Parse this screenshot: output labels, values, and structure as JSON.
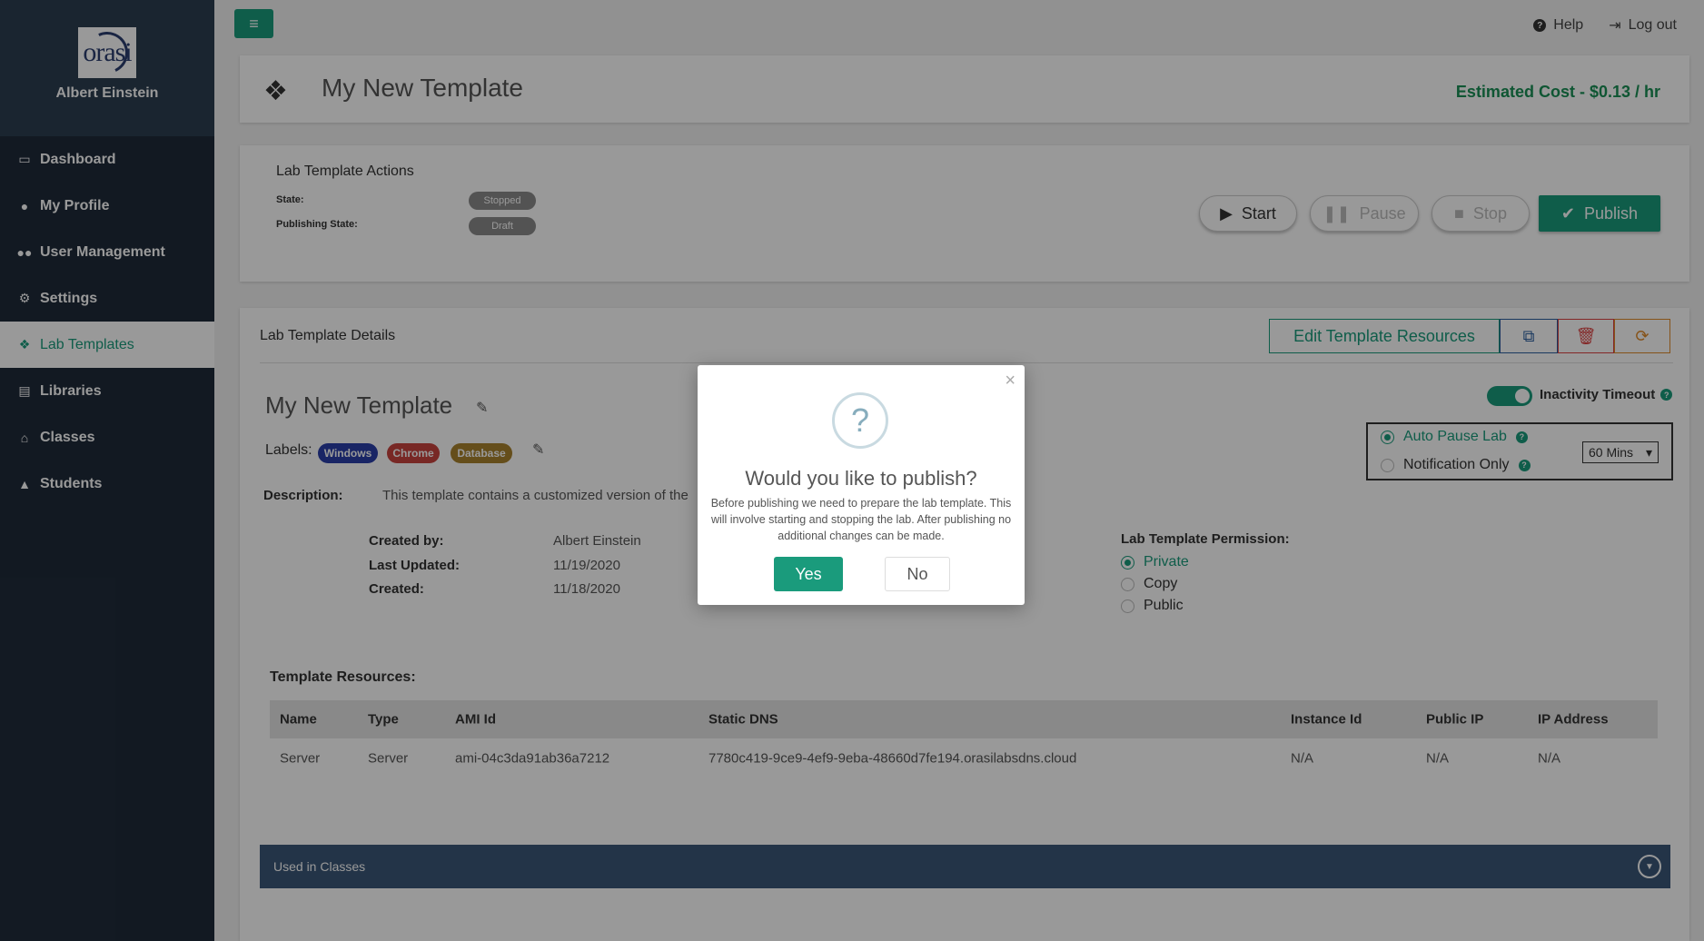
{
  "sidebar": {
    "logo_text": "orasi",
    "user_name": "Albert Einstein",
    "items": [
      {
        "label": "Dashboard",
        "icon": "monitor-icon"
      },
      {
        "label": "My Profile",
        "icon": "user-icon"
      },
      {
        "label": "User Management",
        "icon": "users-icon"
      },
      {
        "label": "Settings",
        "icon": "gear-icon"
      },
      {
        "label": "Lab Templates",
        "icon": "cubes-icon",
        "active": true
      },
      {
        "label": "Libraries",
        "icon": "book-icon"
      },
      {
        "label": "Classes",
        "icon": "bank-icon"
      },
      {
        "label": "Students",
        "icon": "graduation-cap-icon"
      }
    ]
  },
  "topbar": {
    "help_label": "Help",
    "logout_label": "Log out"
  },
  "header": {
    "title": "My New Template",
    "cost": "Estimated Cost - $0.13 / hr"
  },
  "actions": {
    "title": "Lab Template Actions",
    "state_label": "State:",
    "state_value": "Stopped",
    "publishing_label": "Publishing State:",
    "publishing_value": "Draft",
    "start_label": "Start",
    "pause_label": "Pause",
    "stop_label": "Stop",
    "publish_label": "Publish"
  },
  "details": {
    "title": "Lab Template Details",
    "edit_resources_label": "Edit Template Resources",
    "template_name": "My New Template",
    "labels_label": "Labels:",
    "labels": [
      {
        "text": "Windows",
        "color": "#2a3fa8"
      },
      {
        "text": "Chrome",
        "color": "#c9443f"
      },
      {
        "text": "Database",
        "color": "#a8822e"
      }
    ],
    "description_label": "Description:",
    "description": "This template contains a customized version of the",
    "created_by_label": "Created by:",
    "created_by": "Albert Einstein",
    "last_updated_label": "Last Updated:",
    "last_updated": "11/19/2020",
    "created_label": "Created:",
    "created": "11/18/2020",
    "inactivity_label": "Inactivity Timeout",
    "auto_pause_label": "Auto Pause Lab",
    "notification_label": "Notification Only",
    "timeout_value": "60 Mins",
    "permission_title": "Lab Template Permission:",
    "permissions": [
      "Private",
      "Copy",
      "Public"
    ],
    "resources_title": "Template Resources:",
    "table": {
      "headers": [
        "Name",
        "Type",
        "AMI Id",
        "Static DNS",
        "Instance Id",
        "Public IP",
        "IP Address"
      ],
      "rows": [
        [
          "Server",
          "Server",
          "ami-04c3da91ab36a7212",
          "7780c419-9ce9-4ef9-9eba-48660d7fe194.orasilabsdns.cloud",
          "N/A",
          "N/A",
          "N/A"
        ]
      ]
    },
    "used_in_classes": "Used in Classes"
  },
  "modal": {
    "icon": "?",
    "title": "Would you like to publish?",
    "text": "Before publishing we need to prepare the lab template. This will involve starting and stopping the lab. After publishing no additional changes can be made.",
    "yes_label": "Yes",
    "no_label": "No"
  },
  "colors": {
    "accent": "#1a9b7c",
    "sidebar": "#1f2b3a",
    "cost": "#1a8f55"
  }
}
